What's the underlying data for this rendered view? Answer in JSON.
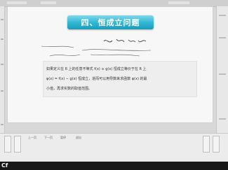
{
  "slide": {
    "heading": "四、恒成立问题",
    "content": {
      "line1": "如果定义在 R 上的任意不等式 f(x) ≥ g(x) 恒成立等价于在 R 上",
      "line2": "φ(x) = f(x) − g(x) 恒成立，进而可以用导数来求函数 φ(x) 的最",
      "line3": "小值，再求实数的取值范围。"
    }
  },
  "controls": [
    {
      "label": "上一页"
    },
    {
      "label": "下一页"
    },
    {
      "label": "暂停"
    },
    {
      "label": "退出"
    }
  ],
  "taskbar": {
    "logo": "Cf"
  }
}
